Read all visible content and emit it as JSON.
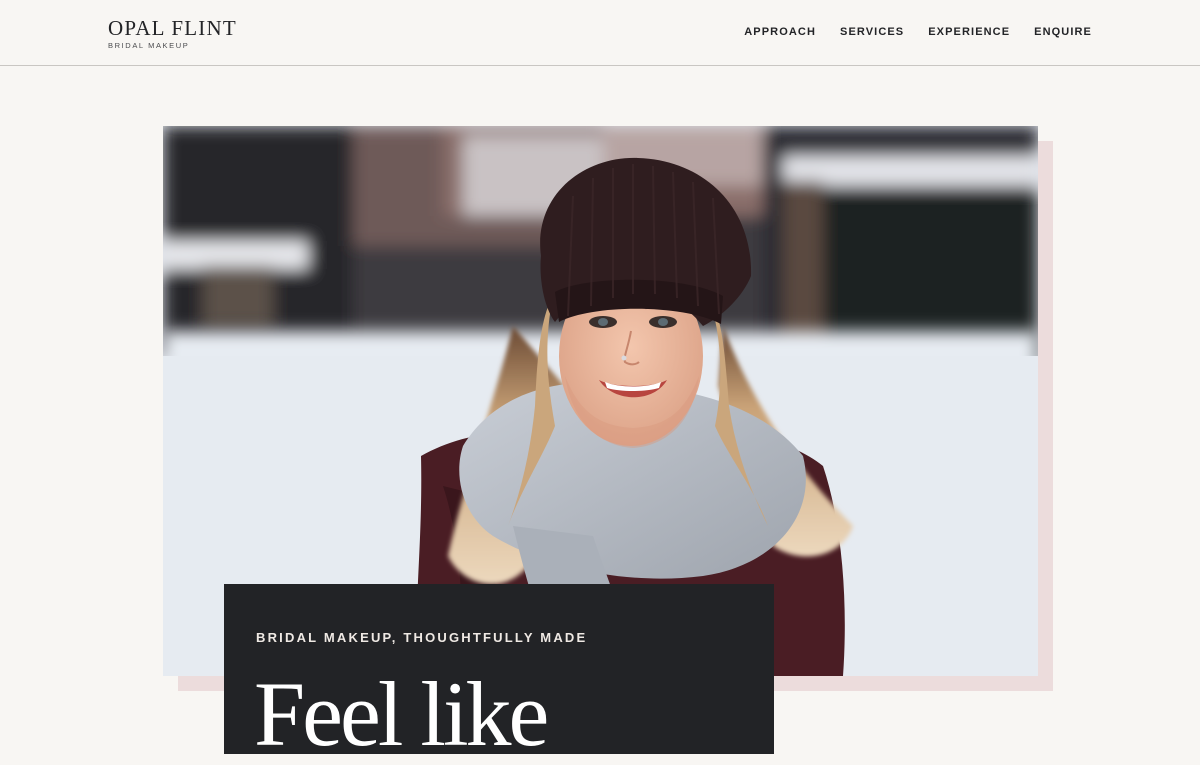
{
  "header": {
    "brand_name": "OPAL FLINT",
    "brand_tagline": "BRIDAL MAKEUP",
    "nav": [
      {
        "label": "APPROACH"
      },
      {
        "label": "SERVICES"
      },
      {
        "label": "EXPERIENCE"
      },
      {
        "label": "ENQUIRE"
      }
    ]
  },
  "hero": {
    "image_alt": "Smiling woman in a dark knit beanie and grey scarf in the snow",
    "eyebrow": "BRIDAL MAKEUP, THOUGHTFULLY MADE",
    "headline": "Feel like"
  },
  "colors": {
    "background": "#f8f6f3",
    "text_dark": "#232427",
    "card_background": "#222326",
    "accent_shadow": "#ecdcdc"
  }
}
